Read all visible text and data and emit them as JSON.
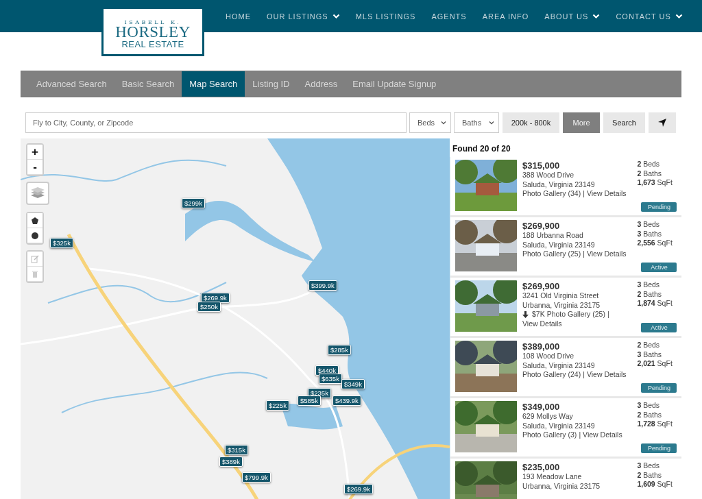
{
  "logo": {
    "line_1": "ISABELL K.",
    "line_2": "HORSLEY",
    "line_3": "REAL ESTATE"
  },
  "nav": [
    {
      "label": "HOME",
      "has_dropdown": false
    },
    {
      "label": "OUR LISTINGS",
      "has_dropdown": true
    },
    {
      "label": "MLS LISTINGS",
      "has_dropdown": false
    },
    {
      "label": "AGENTS",
      "has_dropdown": false
    },
    {
      "label": "AREA INFO",
      "has_dropdown": false
    },
    {
      "label": "ABOUT US",
      "has_dropdown": true
    },
    {
      "label": "CONTACT US",
      "has_dropdown": true
    }
  ],
  "search_tabs": [
    {
      "label": "Advanced Search",
      "selected": false
    },
    {
      "label": "Basic Search",
      "selected": false
    },
    {
      "label": "Map Search",
      "selected": true
    },
    {
      "label": "Listing ID",
      "selected": false
    },
    {
      "label": "Address",
      "selected": false
    },
    {
      "label": "Email Update Signup",
      "selected": false
    }
  ],
  "search_bar": {
    "placeholder": "Fly to City, County, or Zipcode",
    "beds": "Beds",
    "baths": "Baths",
    "price_range": "200k - 800k",
    "more": "More",
    "search": "Search"
  },
  "map": {
    "zoom_in": "+",
    "zoom_out": "-",
    "markers": [
      "$299k",
      "$325k",
      "$399.9k",
      "$269.9k",
      "$250k",
      "$285k",
      "$440k",
      "$635k",
      "$349k",
      "$235k",
      "$585k",
      "$439.9k",
      "$225k",
      "$315k",
      "$389k",
      "$799.9k",
      "$269.9k"
    ]
  },
  "results": {
    "count": "Found 20 of 20",
    "listings": [
      {
        "price": "$315,000",
        "address": "388 Wood Drive",
        "city": "Saluda, Virginia 23149",
        "gallery": "Photo Gallery (34)",
        "separator": "|",
        "details": "View Details",
        "beds": "2",
        "beds_label": "Beds",
        "baths": "2",
        "baths_label": "Baths",
        "sqft": "1,673",
        "sqft_label": "SqFt",
        "status": "Pending"
      },
      {
        "price": "$269,900",
        "address": "188 Urbanna Road",
        "city": "Saluda, Virginia 23149",
        "gallery": "Photo Gallery (25)",
        "separator": "|",
        "details": "View Details",
        "beds": "3",
        "beds_label": "Beds",
        "baths": "3",
        "baths_label": "Baths",
        "sqft": "2,556",
        "sqft_label": "SqFt",
        "status": "Active"
      },
      {
        "price": "$269,900",
        "address": "3241 Old Virginia Street",
        "city": "Urbanna, Virginia 23175",
        "price_drop": "$7K",
        "gallery": "Photo Gallery (25)",
        "separator": "|",
        "details": "View Details",
        "beds": "3",
        "beds_label": "Beds",
        "baths": "2",
        "baths_label": "Baths",
        "sqft": "1,874",
        "sqft_label": "SqFt",
        "status": "Active"
      },
      {
        "price": "$389,000",
        "address": "108 Wood Drive",
        "city": "Saluda, Virginia 23149",
        "gallery": "Photo Gallery (24)",
        "separator": "|",
        "details": "View Details",
        "beds": "2",
        "beds_label": "Beds",
        "baths": "3",
        "baths_label": "Baths",
        "sqft": "2,021",
        "sqft_label": "SqFt",
        "status": "Pending"
      },
      {
        "price": "$349,000",
        "address": "629 Mollys Way",
        "city": "Saluda, Virginia 23149",
        "gallery": "Photo Gallery (3)",
        "separator": "|",
        "details": "View Details",
        "beds": "3",
        "beds_label": "Beds",
        "baths": "2",
        "baths_label": "Baths",
        "sqft": "1,728",
        "sqft_label": "SqFt",
        "status": "Pending"
      },
      {
        "price": "$235,000",
        "address": "193 Meadow Lane",
        "city": "Urbanna, Virginia 23175",
        "beds": "3",
        "beds_label": "Beds",
        "baths": "2",
        "baths_label": "Baths",
        "sqft": "1,609",
        "sqft_label": "SqFt"
      }
    ]
  }
}
